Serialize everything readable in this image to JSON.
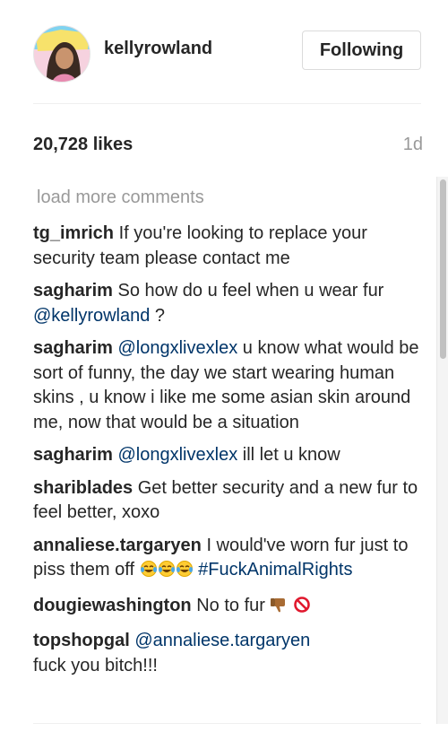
{
  "post": {
    "username": "kellyrowland",
    "follow_label": "Following",
    "likes": "20,728 likes",
    "age": "1d",
    "load_more": "load more comments"
  },
  "comments": [
    {
      "user": "tg_imrich",
      "text": "If you're looking to replace your security team please contact me"
    },
    {
      "user": "sagharim",
      "text": "So how do u feel when u wear fur",
      "mention": "@kellyrowland",
      "after": "?"
    },
    {
      "user": "sagharim",
      "mention": "@longxlivexlex",
      "text": "u know what would be sort of funny, the day we start wearing human skins , u know i like me some asian skin around me, now that would be a situation"
    },
    {
      "user": "sagharim",
      "mention": "@longxlivexlex",
      "text": "ill let u know"
    },
    {
      "user": "shariblades",
      "text": "Get better security and a new fur to feel better, xoxo"
    },
    {
      "user": "annaliese.targaryen",
      "text": "I would've worn fur just to piss them off",
      "hashtag": "#FuckAnimalRights"
    },
    {
      "user": "dougiewashington",
      "text": "No to fur"
    },
    {
      "user": "topshopgal",
      "mention": "@annaliese.targaryen",
      "text": "fuck you bitch!!!"
    }
  ],
  "icons": {
    "laugh": "tears-of-joy-icon",
    "thumbs_down": "thumbs-down-icon",
    "prohibited": "prohibited-icon"
  }
}
